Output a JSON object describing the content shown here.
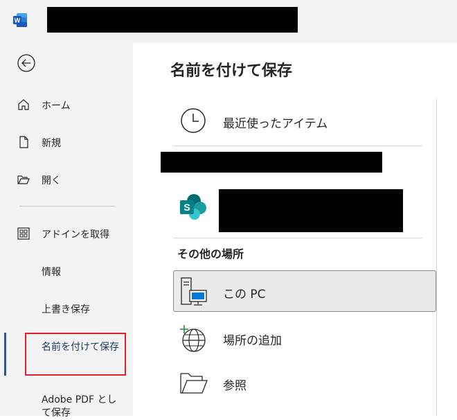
{
  "app": {
    "icon": "word-icon",
    "brand_color": "#2b579a"
  },
  "sidebar": {
    "items": [
      {
        "label": "ホーム",
        "icon": "home-icon"
      },
      {
        "label": "新規",
        "icon": "new-document-icon"
      },
      {
        "label": "開く",
        "icon": "open-folder-icon"
      },
      {
        "label": "アドインを取得",
        "icon": "add-ins-grid-icon"
      },
      {
        "label": "情報"
      },
      {
        "label": "上書き保存"
      },
      {
        "label": "名前を付けて保存"
      },
      {
        "label": "Adobe PDF として保存"
      }
    ]
  },
  "main": {
    "title": "名前を付けて保存",
    "recent_label": "最近使ったアイテム",
    "other_locations_title": "その他の場所",
    "locations": [
      {
        "label": "この PC",
        "icon": "this-pc-icon"
      },
      {
        "label": "場所の追加",
        "icon": "add-place-globe-icon"
      },
      {
        "label": "参照",
        "icon": "browse-folder-icon"
      }
    ]
  },
  "colors": {
    "highlight_border": "#e0212c",
    "active_marker": "#2b579a"
  }
}
